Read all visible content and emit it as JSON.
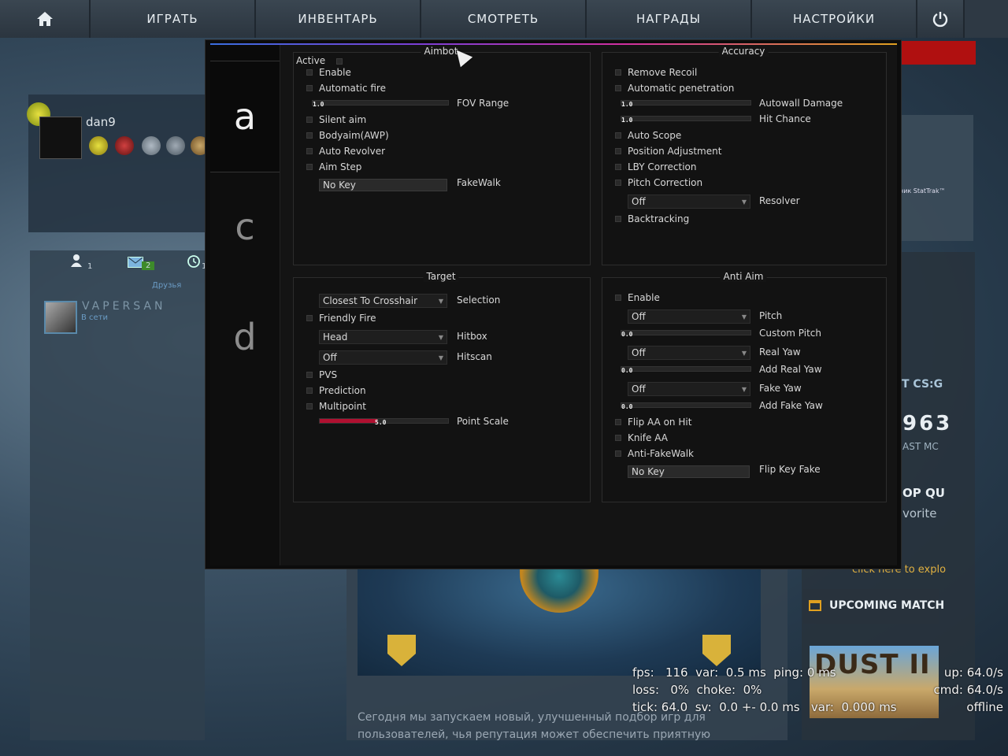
{
  "nav": {
    "home_icon": "home-icon",
    "tabs": [
      "ИГРАТЬ",
      "ИНВЕНТАРЬ",
      "СМОТРЕТЬ",
      "НАГРАДЫ",
      "НАСТРОЙКИ"
    ],
    "power_icon": "power-icon"
  },
  "player": {
    "name": "dan9"
  },
  "friends": {
    "counts": [
      "1",
      "2",
      "1"
    ],
    "label": "Друзья",
    "items": [
      {
        "name": "VAPERSAN",
        "status": "В сети"
      }
    ]
  },
  "store": {
    "stattrak_label": "ник StatTrak™"
  },
  "right_column": {
    "title_fragment": "T CS:G",
    "number_fragment": "963",
    "sub_fragment": "AST MC",
    "shop_fragment": "OP QU",
    "favorite_fragment": "vorite",
    "explore_fragment": "click here to explo",
    "upcoming": "UPCOMING MATCH",
    "map_name": "DUST II"
  },
  "news": {
    "text": "Сегодня мы запускаем новый, улучшенный подбор игр для пользователей, чья репутация может обеспечить приятную"
  },
  "net_graph": {
    "line1": "fps:   116  var:  0.5 ms  ping: 0 ms",
    "line2": "loss:   0%  choke:  0%",
    "line3": "tick: 64.0  sv:  0.0 +- 0.0 ms   var:  0.000 ms",
    "up": "up: 64.0/s",
    "cmd": "cmd: 64.0/s",
    "offline": "offline"
  },
  "menu": {
    "tabs": [
      "a",
      "c",
      "d"
    ],
    "active_tab": "a",
    "accent_color": "#b01030",
    "aimbot": {
      "title": "Aimbot",
      "active_label": "Active",
      "enable": "Enable",
      "automatic_fire": "Automatic fire",
      "fov_value": "1.0",
      "fov_label": "FOV Range",
      "silent_aim": "Silent aim",
      "bodyaim": "Bodyaim(AWP)",
      "auto_revolver": "Auto Revolver",
      "aim_step": "Aim Step",
      "fakewalk_key": "No Key",
      "fakewalk_label": "FakeWalk"
    },
    "accuracy": {
      "title": "Accuracy",
      "remove_recoil": "Remove Recoil",
      "automatic_penetration": "Automatic penetration",
      "autowall_value": "1.0",
      "autowall_label": "Autowall Damage",
      "hitchance_value": "1.0",
      "hitchance_label": "Hit Chance",
      "auto_scope": "Auto Scope",
      "position_adjustment": "Position Adjustment",
      "lby_correction": "LBY Correction",
      "pitch_correction": "Pitch Correction",
      "resolver_value": "Off",
      "resolver_label": "Resolver",
      "backtracking": "Backtracking"
    },
    "target": {
      "title": "Target",
      "selection_value": "Closest To Crosshair",
      "selection_label": "Selection",
      "friendly_fire": "Friendly Fire",
      "hitbox_value": "Head",
      "hitbox_label": "Hitbox",
      "hitscan_value": "Off",
      "hitscan_label": "Hitscan",
      "pvs": "PVS",
      "prediction": "Prediction",
      "multipoint": "Multipoint",
      "point_scale_value": "5.0",
      "point_scale_fraction": 0.45,
      "point_scale_label": "Point Scale"
    },
    "antiaim": {
      "title": "Anti Aim",
      "enable": "Enable",
      "pitch_value": "Off",
      "pitch_label": "Pitch",
      "custom_pitch_value": "0.0",
      "custom_pitch_label": "Custom Pitch",
      "real_yaw_value": "Off",
      "real_yaw_label": "Real Yaw",
      "add_real_yaw_value": "0.0",
      "add_real_yaw_label": "Add Real Yaw",
      "fake_yaw_value": "Off",
      "fake_yaw_label": "Fake Yaw",
      "add_fake_yaw_value": "0.0",
      "add_fake_yaw_label": "Add Fake Yaw",
      "flip_aa_on_hit": "Flip AA on Hit",
      "knife_aa": "Knife AA",
      "anti_fakewalk": "Anti-FakeWalk",
      "flip_key_value": "No Key",
      "flip_key_label": "Flip Key Fake"
    }
  }
}
